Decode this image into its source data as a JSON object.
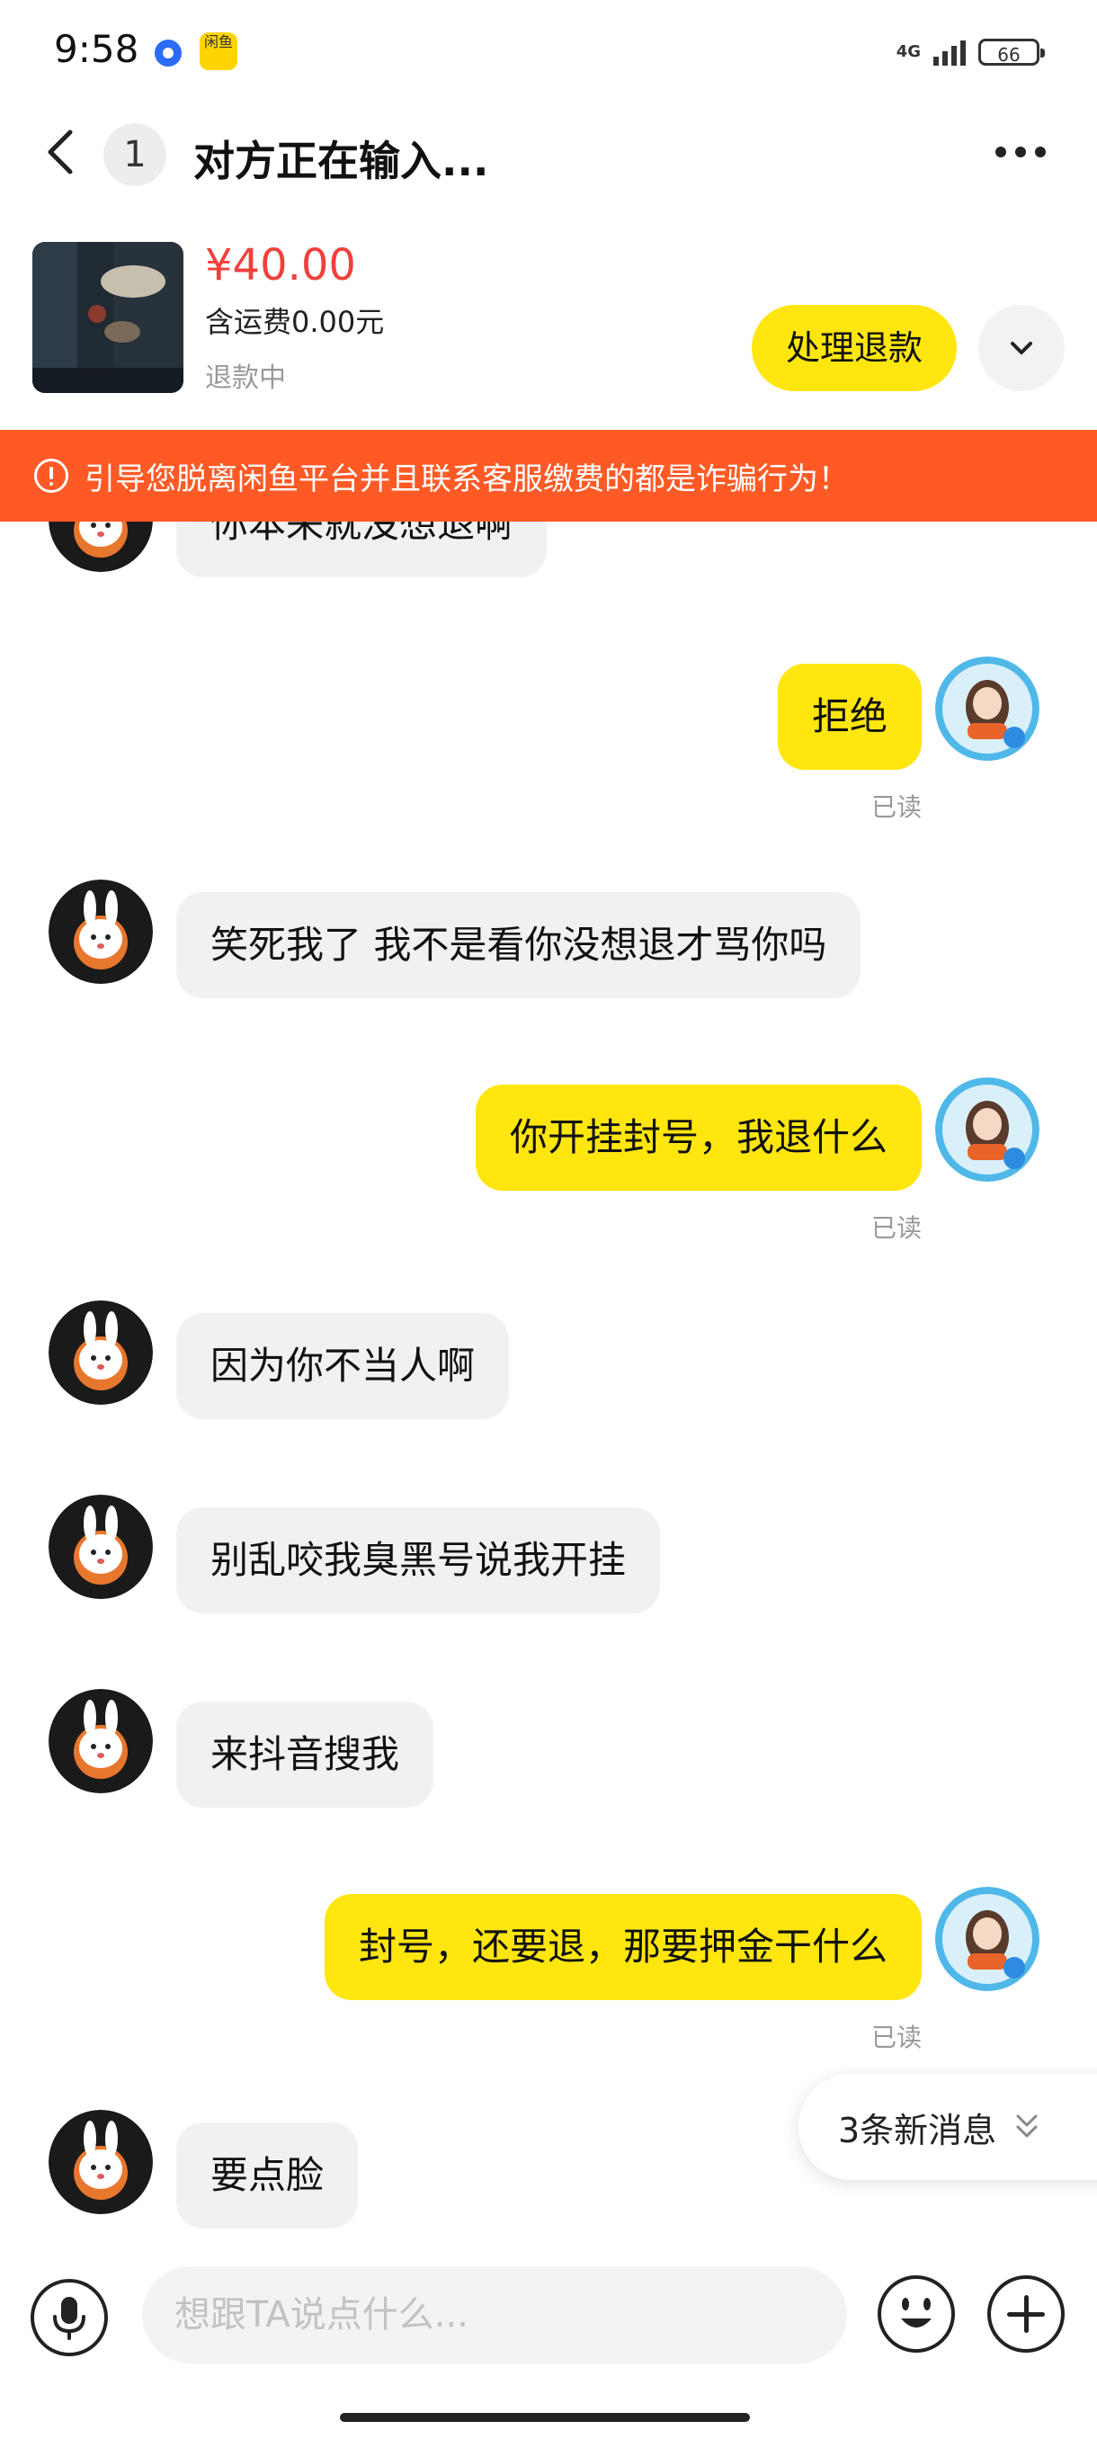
{
  "status_bar": {
    "time": "9:58",
    "network": "4G",
    "battery": "66",
    "app_icon_text": "闲鱼"
  },
  "header": {
    "unread_count": "1",
    "title": "对方正在输入..."
  },
  "product": {
    "price": "¥40.00",
    "shipping": "含运费0.00元",
    "status": "退款中",
    "action_label": "处理退款"
  },
  "warning": {
    "text": "引导您脱离闲鱼平台并且联系客服缴费的都是诈骗行为！"
  },
  "messages": [
    {
      "side": "in",
      "text": "你本来就没想退啊"
    },
    {
      "side": "out",
      "text": "拒绝",
      "read": "已读"
    },
    {
      "side": "in",
      "text": "笑死我了 我不是看你没想退才骂你吗"
    },
    {
      "side": "out",
      "text": "你开挂封号，我退什么",
      "read": "已读"
    },
    {
      "side": "in",
      "text": "因为你不当人啊"
    },
    {
      "side": "in",
      "text": "别乱咬我臭黑号说我开挂"
    },
    {
      "side": "in",
      "text": "来抖音搜我"
    },
    {
      "side": "out",
      "text": "封号，还要退，那要押金干什么",
      "read": "已读"
    },
    {
      "side": "in",
      "text": "要点脸"
    }
  ],
  "new_messages": {
    "label": "3条新消息"
  },
  "input": {
    "placeholder": "想跟TA说点什么..."
  },
  "colors": {
    "accent_yellow": "#ffe60f",
    "warning_orange": "#ff5a26",
    "price_red": "#f0403c",
    "incoming_bubble": "#f1f1f3"
  },
  "icons": {
    "back": "chevron-left-icon",
    "more": "more-dots-icon",
    "expand": "chevron-down-icon",
    "warning": "exclamation-circle-icon",
    "voice": "microphone-icon",
    "emoji": "smiley-icon",
    "plus": "plus-circle-icon",
    "new_messages": "double-chevron-down-icon"
  }
}
